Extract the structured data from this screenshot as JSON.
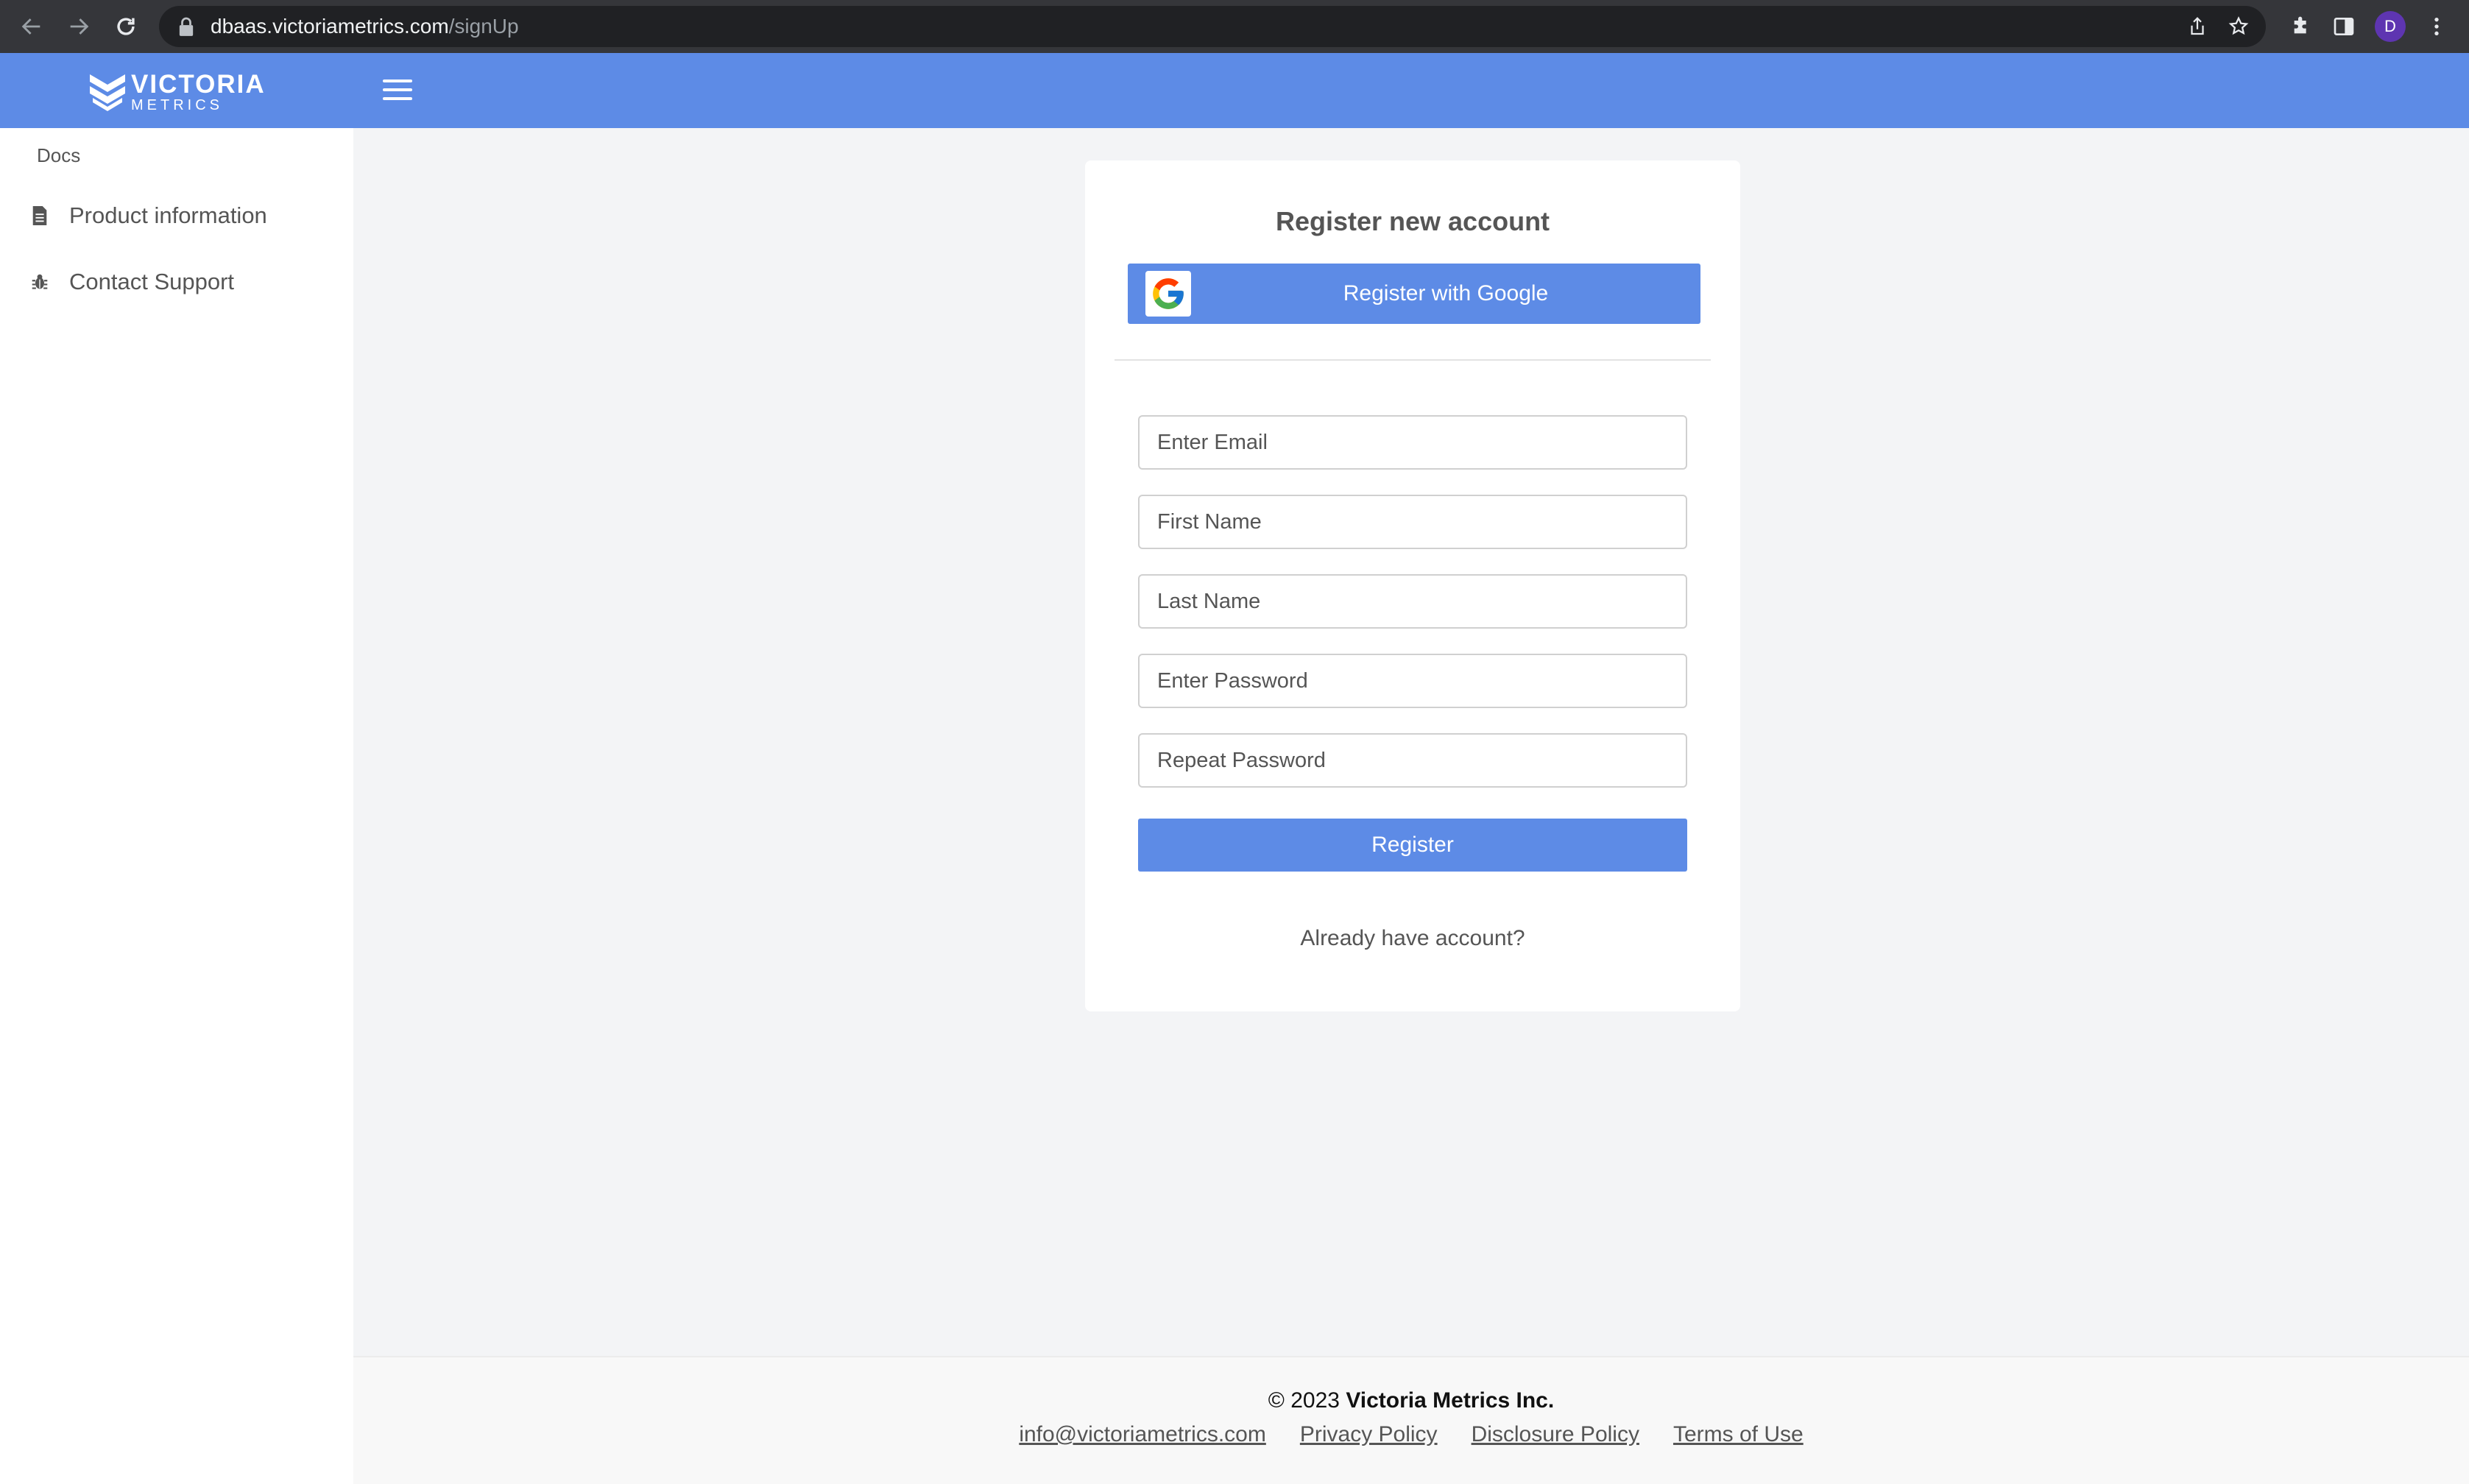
{
  "browser": {
    "url_host": "dbaas.victoriametrics.com",
    "url_path": "/signUp",
    "profile_initial": "D"
  },
  "header": {
    "logo_main": "VICTORIA",
    "logo_sub": "METRICS"
  },
  "sidebar": {
    "heading": "Docs",
    "items": [
      {
        "label": "Product information",
        "icon": "document-icon"
      },
      {
        "label": "Contact Support",
        "icon": "bug-icon"
      }
    ]
  },
  "register_form": {
    "title": "Register new account",
    "google_button": "Register with Google",
    "email_placeholder": "Enter Email",
    "first_name_placeholder": "First Name",
    "last_name_placeholder": "Last Name",
    "password_placeholder": "Enter Password",
    "repeat_password_placeholder": "Repeat Password",
    "submit_label": "Register",
    "login_link": "Already have account?"
  },
  "footer": {
    "copyright_prefix": "© 2023",
    "company": "Victoria Metrics Inc.",
    "links": [
      "info@victoriametrics.com",
      "Privacy Policy",
      "Disclosure Policy",
      "Terms of Use"
    ]
  },
  "colors": {
    "brand_blue": "#5d8be6",
    "chrome_dark": "#35363a"
  }
}
